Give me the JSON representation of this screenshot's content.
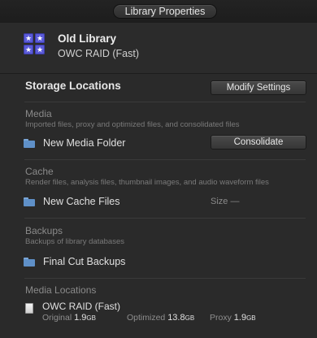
{
  "window": {
    "title": "Library Properties"
  },
  "library": {
    "name": "Old Library",
    "volume": "OWC RAID (Fast)",
    "icon": "library-stars-icon"
  },
  "storage": {
    "title": "Storage Locations",
    "modify_button": "Modify Settings",
    "media": {
      "title": "Media",
      "description": "Imported files, proxy and optimized files, and consolidated files",
      "folder": "New Media Folder",
      "consolidate_button": "Consolidate"
    },
    "cache": {
      "title": "Cache",
      "description": "Render files, analysis files, thumbnail images, and audio waveform files",
      "folder": "New Cache Files",
      "size_label": "Size —"
    },
    "backups": {
      "title": "Backups",
      "description": "Backups of library databases",
      "folder": "Final Cut Backups"
    }
  },
  "media_locations": {
    "title": "Media Locations",
    "drive": "OWC RAID (Fast)",
    "original": {
      "label": "Original",
      "value": "1.9",
      "unit": "GB"
    },
    "optimized": {
      "label": "Optimized",
      "value": "13.8",
      "unit": "GB"
    },
    "proxy": {
      "label": "Proxy",
      "value": "1.9",
      "unit": "GB"
    }
  }
}
